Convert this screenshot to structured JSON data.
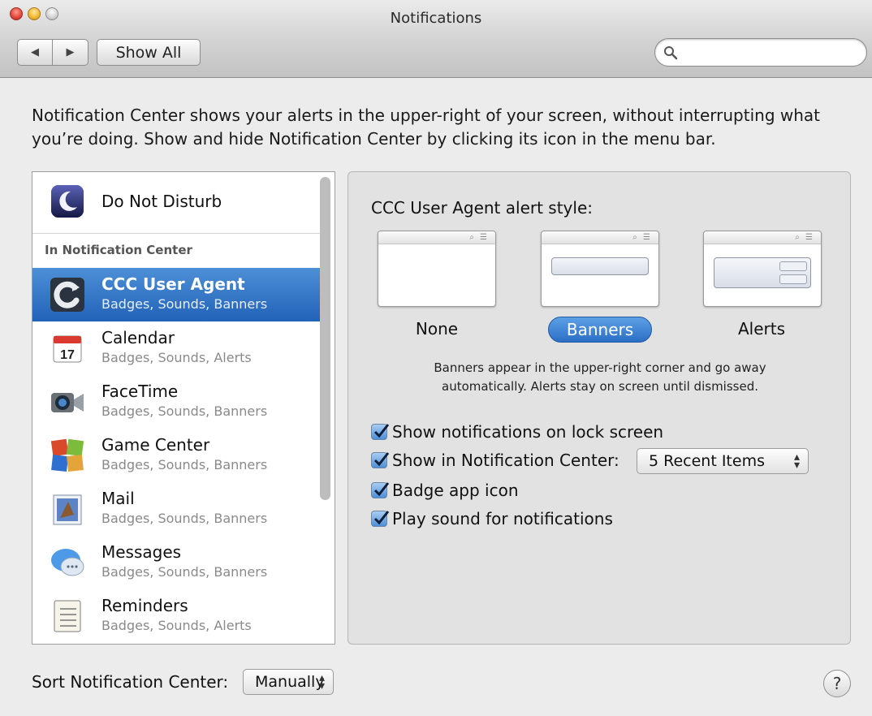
{
  "window": {
    "title": "Notifications",
    "show_all_label": "Show All",
    "back_glyph": "◀",
    "forward_glyph": "▶",
    "search_placeholder": ""
  },
  "description": "Notification Center shows your alerts in the upper-right of your screen, without interrupting what you’re doing. Show and hide Notification Center by clicking its icon in the menu bar.",
  "sidebar": {
    "do_not_disturb": {
      "label": "Do Not Disturb",
      "icon": "moon-icon"
    },
    "section_header": "In Notification Center",
    "apps": [
      {
        "name": "CCC User Agent",
        "subtitle": "Badges, Sounds, Banners",
        "icon": "ccc-icon",
        "selected": true
      },
      {
        "name": "Calendar",
        "subtitle": "Badges, Sounds, Alerts",
        "icon": "calendar-icon",
        "calendar_day": "17"
      },
      {
        "name": "FaceTime",
        "subtitle": "Badges, Sounds, Banners",
        "icon": "facetime-icon"
      },
      {
        "name": "Game Center",
        "subtitle": "Badges, Sounds, Banners",
        "icon": "game-center-icon"
      },
      {
        "name": "Mail",
        "subtitle": "Badges, Sounds, Banners",
        "icon": "mail-icon"
      },
      {
        "name": "Messages",
        "subtitle": "Badges, Sounds, Banners",
        "icon": "messages-icon"
      },
      {
        "name": "Reminders",
        "subtitle": "Badges, Sounds, Alerts",
        "icon": "reminders-icon"
      }
    ]
  },
  "detail": {
    "alert_style_label": "CCC User Agent alert style:",
    "styles": [
      {
        "label": "None",
        "selected": false
      },
      {
        "label": "Banners",
        "selected": true
      },
      {
        "label": "Alerts",
        "selected": false
      }
    ],
    "style_description_line1": "Banners appear in the upper-right corner and go away",
    "style_description_line2": "automatically. Alerts stay on screen until dismissed.",
    "options": [
      {
        "label": "Show notifications on lock screen",
        "checked": true
      },
      {
        "label": "Show in Notification Center:",
        "checked": true
      },
      {
        "label": "Badge app icon",
        "checked": true
      },
      {
        "label": "Play sound for notifications",
        "checked": true
      }
    ],
    "recent_items_value": "5 Recent Items"
  },
  "footer": {
    "sort_label": "Sort Notification Center:",
    "sort_value": "Manually",
    "help_glyph": "?"
  },
  "colors": {
    "selection": "#2f70c4",
    "window_bg": "#ececec"
  }
}
